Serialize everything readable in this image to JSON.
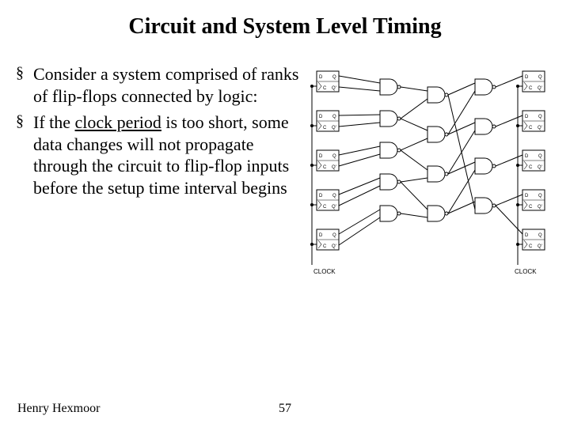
{
  "title": "Circuit and System Level Timing",
  "bullets": {
    "b1_pre": "Consider a system comprised of ranks of flip-flops connected by logic:",
    "b2_pre": "If the ",
    "b2_underline": "clock period",
    "b2_post": " is too short, some data changes will not propagate through the circuit to flip-flop inputs before the setup time interval begins"
  },
  "diagram": {
    "flipflop": {
      "D": "D",
      "Q": "Q",
      "C": "C",
      "Qbar": "Q'"
    },
    "clock_left": "CLOCK",
    "clock_right": "CLOCK"
  },
  "footer": {
    "author": "Henry Hexmoor",
    "page": "57"
  }
}
